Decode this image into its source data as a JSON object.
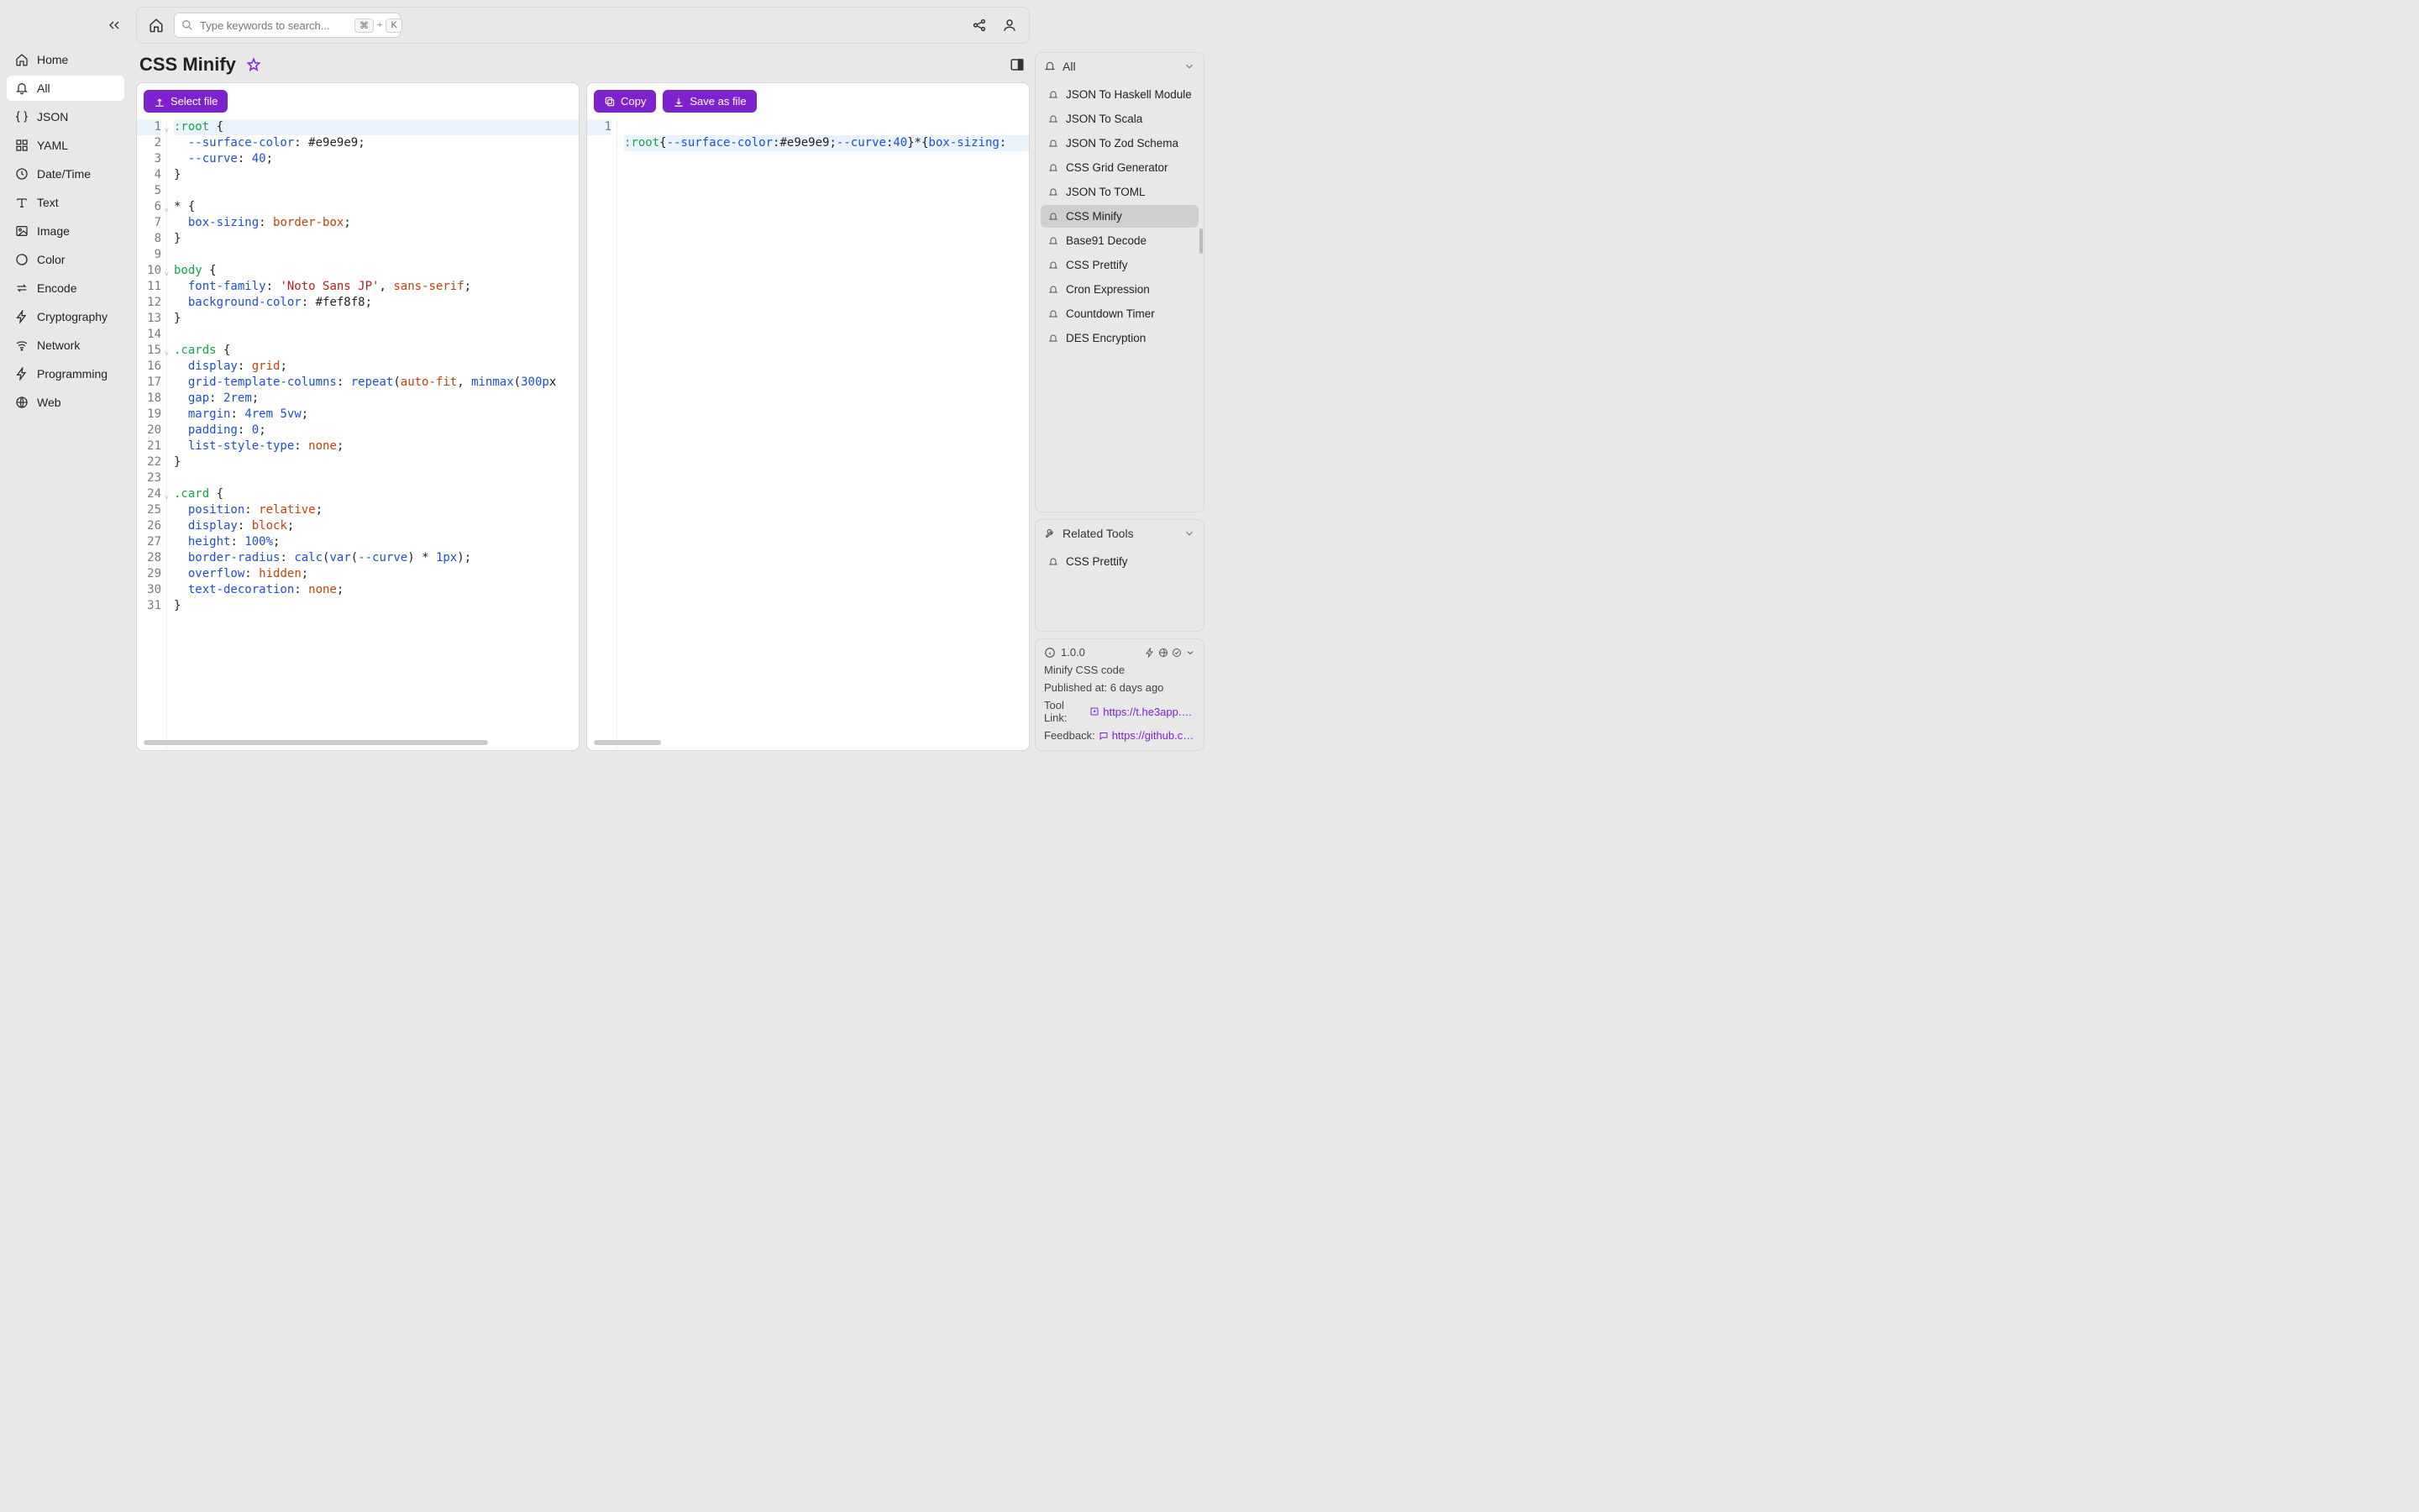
{
  "search": {
    "placeholder": "Type keywords to search...",
    "kbd1": "⌘",
    "kbd_plus": "+",
    "kbd2": "K"
  },
  "page": {
    "title": "CSS Minify"
  },
  "nav": {
    "items": [
      {
        "label": "Home"
      },
      {
        "label": "All"
      },
      {
        "label": "JSON"
      },
      {
        "label": "YAML"
      },
      {
        "label": "Date/Time"
      },
      {
        "label": "Text"
      },
      {
        "label": "Image"
      },
      {
        "label": "Color"
      },
      {
        "label": "Encode"
      },
      {
        "label": "Cryptography"
      },
      {
        "label": "Network"
      },
      {
        "label": "Programming"
      },
      {
        "label": "Web"
      }
    ]
  },
  "buttons": {
    "select_file": "Select file",
    "copy": "Copy",
    "save_as": "Save as file"
  },
  "input_editor": {
    "line_count": 31,
    "fold_lines": [
      1,
      6,
      10,
      15,
      24
    ]
  },
  "right": {
    "filter_label": "All",
    "tools": [
      "JSON To Haskell Module",
      "JSON To Scala",
      "JSON To Zod Schema",
      "CSS Grid Generator",
      "JSON To TOML",
      "CSS Minify",
      "Base91 Decode",
      "CSS Prettify",
      "Cron Expression",
      "Countdown Timer",
      "DES Encryption"
    ],
    "active_tool_index": 5,
    "related_label": "Related Tools",
    "related": [
      "CSS Prettify"
    ]
  },
  "info": {
    "version": "1.0.0",
    "desc": "Minify CSS code",
    "published_label": "Published at:",
    "published_value": "6 days ago",
    "tool_link_label": "Tool Link:",
    "tool_link": "https://t.he3app.co…",
    "feedback_label": "Feedback:",
    "feedback_link": "https://github.com/…"
  }
}
